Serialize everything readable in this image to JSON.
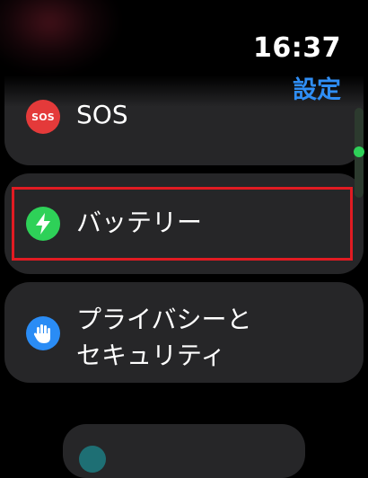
{
  "status": {
    "time": "16:37"
  },
  "navigation": {
    "back_title": "設定"
  },
  "settings_list": {
    "items": [
      {
        "label": "SOS",
        "icon": "sos-icon",
        "icon_text": "SOS",
        "color": "#e43a3a"
      },
      {
        "label": "バッテリー",
        "icon": "bolt-icon",
        "color": "#2ed158",
        "highlighted": true
      },
      {
        "label_line1": "プライバシーと",
        "label_line2": "セキュリティ",
        "icon": "hand-icon",
        "color": "#2a8cf5"
      }
    ]
  },
  "highlight_color": "#e11b22",
  "accent_color": "#2f8ef5"
}
